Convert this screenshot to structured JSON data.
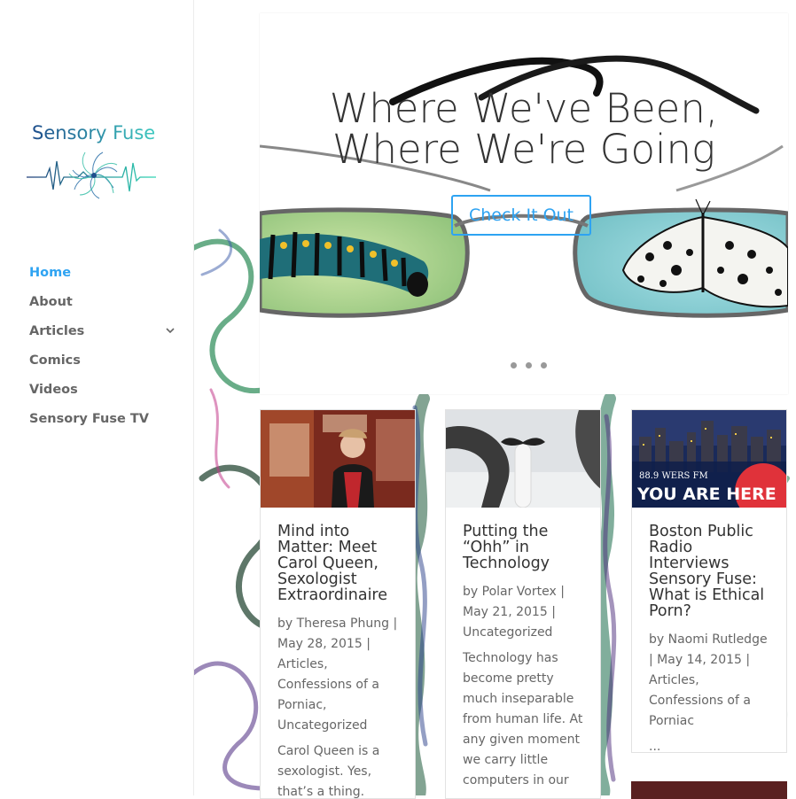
{
  "logo": {
    "title": "Sensory Fuse",
    "colors": {
      "title_gradient_start": "#1f4e8c",
      "title_gradient_end": "#3ec9c0",
      "wave_left": "#1f3d7a",
      "wave_right": "#2fd6b3"
    }
  },
  "nav": {
    "items": [
      {
        "label": "Home",
        "active": true
      },
      {
        "label": "About"
      },
      {
        "label": "Articles",
        "has_submenu": true
      },
      {
        "label": "Comics"
      },
      {
        "label": "Videos"
      },
      {
        "label": "Sensory Fuse TV"
      }
    ],
    "colors": {
      "active": "#2ea3f2",
      "default": "#666666"
    }
  },
  "slider": {
    "heading_line1": "Where We've Been,",
    "heading_line2": "Where We're Going",
    "button_label": "Check It Out",
    "dots": 3,
    "colors": {
      "accent": "#2ea3f2"
    }
  },
  "posts": [
    {
      "title": "Mind into Matter: Meet Carol Queen, Sexologist Extraordinaire",
      "by": "by",
      "author": "Theresa Phung",
      "date": "May 28, 2015",
      "categories": "Articles, Confessions of a Porniac, Uncategorized",
      "excerpt": "Carol Queen is a sexologist. Yes, that’s a thing. What does being a"
    },
    {
      "title": "Putting the “Ohh” in Technology",
      "by": "by",
      "author": "Polar Vortex",
      "date": "May 21, 2015",
      "categories": "Uncategorized",
      "excerpt": "Technology has become pretty much inseparable from human life. At any given moment we carry little computers in our"
    },
    {
      "title": "Boston Public Radio Interviews Sensory Fuse: What is Ethical Porn?",
      "by": "by",
      "author": "Naomi Rutledge",
      "date": "May 14, 2015",
      "categories": "Articles, Confessions of a Porniac",
      "excerpt": "...",
      "thumb_text": {
        "station": "88.9 WERS FM",
        "banner": "YOU ARE HERE"
      }
    }
  ],
  "separator": "|"
}
